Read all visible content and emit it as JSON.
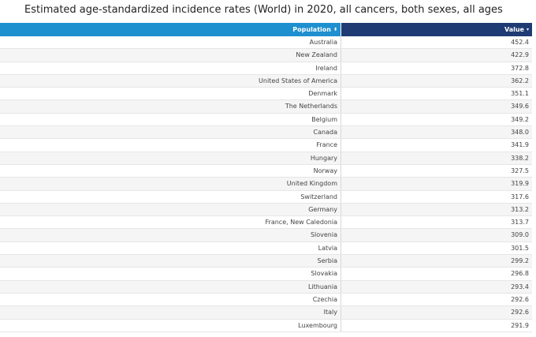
{
  "title": "Estimated age-standardized incidence rates (World) in 2020, all cancers, both sexes, all ages",
  "table": {
    "headers": {
      "population": "Population",
      "value": "Value"
    },
    "sort_icons": {
      "population": "⬍",
      "value": "▾"
    }
  },
  "chart_data": {
    "type": "table",
    "title": "Estimated age-standardized incidence rates (World) in 2020, all cancers, both sexes, all ages",
    "columns": [
      "Population",
      "Value"
    ],
    "rows": [
      {
        "population": "Australia",
        "value": "452.4"
      },
      {
        "population": "New Zealand",
        "value": "422.9"
      },
      {
        "population": "Ireland",
        "value": "372.8"
      },
      {
        "population": "United States of America",
        "value": "362.2"
      },
      {
        "population": "Denmark",
        "value": "351.1"
      },
      {
        "population": "The Netherlands",
        "value": "349.6"
      },
      {
        "population": "Belgium",
        "value": "349.2"
      },
      {
        "population": "Canada",
        "value": "348.0"
      },
      {
        "population": "France",
        "value": "341.9"
      },
      {
        "population": "Hungary",
        "value": "338.2"
      },
      {
        "population": "Norway",
        "value": "327.5"
      },
      {
        "population": "United Kingdom",
        "value": "319.9"
      },
      {
        "population": "Switzerland",
        "value": "317.6"
      },
      {
        "population": "Germany",
        "value": "313.2"
      },
      {
        "population": "France, New Caledonia",
        "value": "313.7"
      },
      {
        "population": "Slovenia",
        "value": "309.0"
      },
      {
        "population": "Latvia",
        "value": "301.5"
      },
      {
        "population": "Serbia",
        "value": "299.2"
      },
      {
        "population": "Slovakia",
        "value": "296.8"
      },
      {
        "population": "Lithuania",
        "value": "293.4"
      },
      {
        "population": "Czechia",
        "value": "292.6"
      },
      {
        "population": "Italy",
        "value": "292.6"
      },
      {
        "population": "Luxembourg",
        "value": "291.9"
      }
    ]
  }
}
